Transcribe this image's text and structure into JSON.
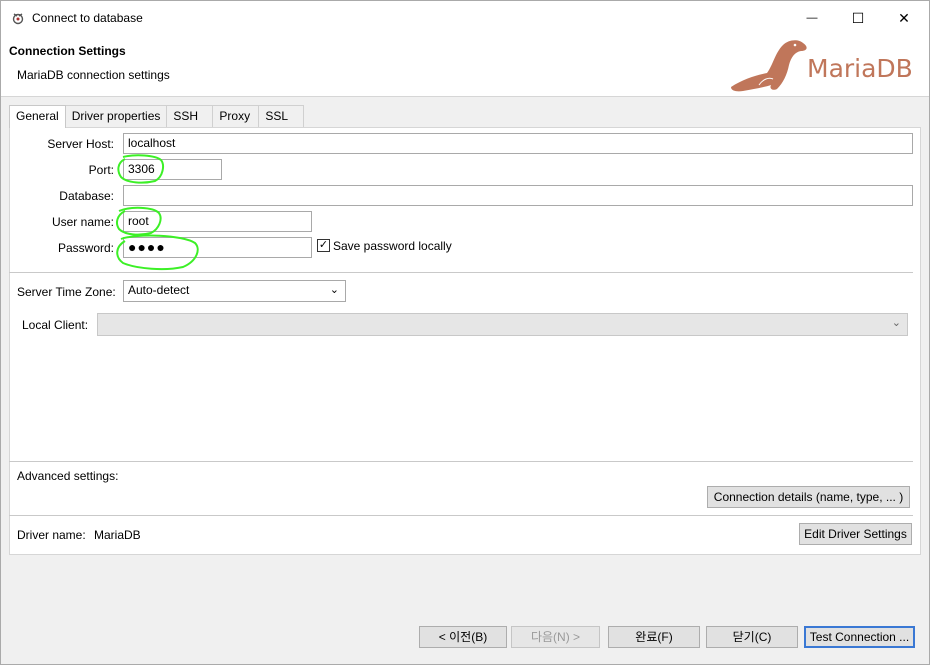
{
  "window": {
    "title": "Connect to database",
    "minimize_glyph": "—",
    "maximize_glyph": "☐",
    "close_glyph": "✕"
  },
  "header": {
    "title": "Connection Settings",
    "subtitle": "MariaDB connection settings",
    "logo_text": "MariaDB"
  },
  "tabs": [
    {
      "label": "General",
      "active": true
    },
    {
      "label": "Driver properties"
    },
    {
      "label": "SSH"
    },
    {
      "label": "Proxy"
    },
    {
      "label": "SSL"
    }
  ],
  "form": {
    "server_host_label": "Server Host:",
    "server_host_value": "localhost",
    "port_label": "Port:",
    "port_value": "3306",
    "database_label": "Database:",
    "database_value": "",
    "username_label": "User name:",
    "username_value": "root",
    "password_label": "Password:",
    "password_value": "●●●●",
    "save_password_label": "Save password locally",
    "save_password_checked": "✓",
    "timezone_label": "Server Time Zone:",
    "timezone_value": "Auto-detect",
    "local_client_label": "Local Client:",
    "local_client_value": "",
    "advanced_label": "Advanced settings:",
    "connection_details_button": "Connection details (name, type, ... )",
    "driver_name_label": "Driver name:",
    "driver_name_value": "MariaDB",
    "edit_driver_button": "Edit Driver Settings"
  },
  "footer": {
    "back_button": "< 이전(B)",
    "next_button": "다음(N) >",
    "finish_button": "완료(F)",
    "close_button": "닫기(C)",
    "test_button": "Test Connection ..."
  },
  "colors": {
    "highlight": "#3cf026",
    "logo": "#c0765a",
    "primary_border": "#3a78d4"
  }
}
